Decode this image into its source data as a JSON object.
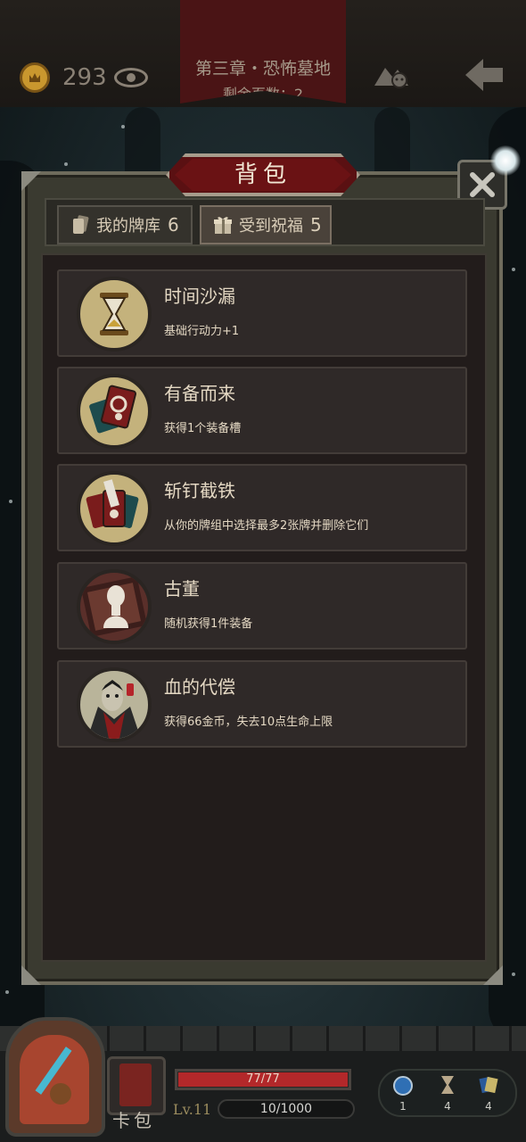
{
  "hud": {
    "gold": "293",
    "chapter_title": "第三章・恐怖墓地",
    "pages_left": "剩余页数：2"
  },
  "panel": {
    "title": "背包",
    "tabs": [
      {
        "label": "我的牌库",
        "count": "6",
        "icon": "card-stack-icon"
      },
      {
        "label": "受到祝福",
        "count": "5",
        "icon": "gift-box-icon"
      }
    ],
    "blessings": [
      {
        "title": "时间沙漏",
        "desc": "基础行动力+1",
        "icon": "hourglass-icon"
      },
      {
        "title": "有备而来",
        "desc": "获得1个装备槽",
        "icon": "equipment-card-icon"
      },
      {
        "title": "斩钉截铁",
        "desc": "从你的牌组中选择最多2张牌并删除它们",
        "icon": "cleaver-card-icon"
      },
      {
        "title": "古董",
        "desc": "随机获得1件装备",
        "icon": "antique-bust-icon"
      },
      {
        "title": "血的代偿",
        "desc": "获得66金币，失去10点生命上限",
        "icon": "vampire-icon"
      }
    ]
  },
  "bottom": {
    "deck_label": "卡包",
    "hp_text": "77/77",
    "hp_fraction": 1.0,
    "level": "Lv.11",
    "xp_text": "10/1000",
    "resources": [
      {
        "icon": "orb-icon",
        "count": "1"
      },
      {
        "icon": "hourglass-small-icon",
        "count": "4"
      },
      {
        "icon": "cards-icon",
        "count": "4"
      }
    ]
  },
  "colors": {
    "banner_red": "#5a1012",
    "hp_red": "#b3282a",
    "panel_bg": "#3a3a30",
    "card_bg": "#2f2928"
  }
}
